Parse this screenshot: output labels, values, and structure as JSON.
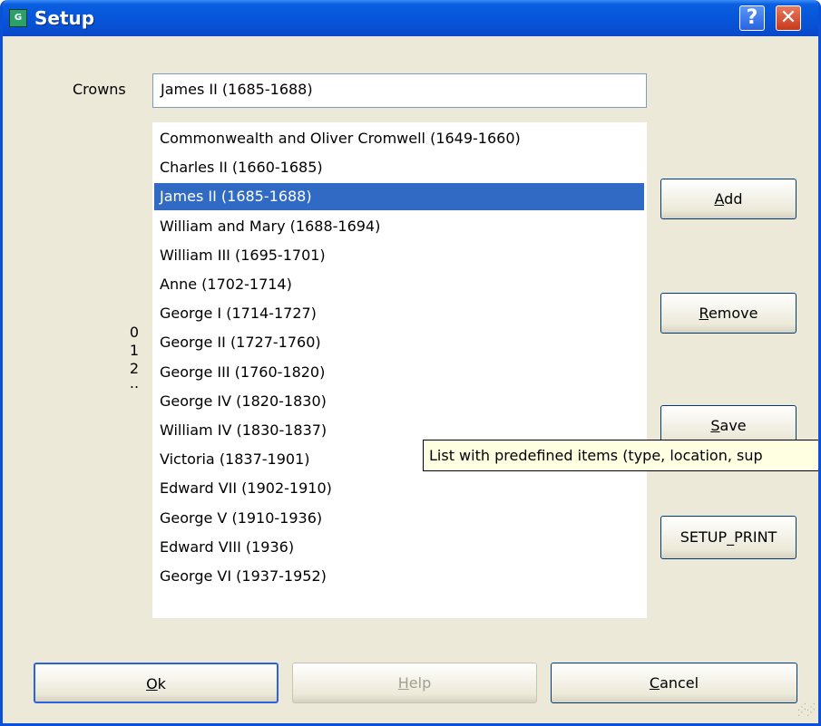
{
  "window": {
    "title": "Setup",
    "app_icon": "setup-app-icon",
    "help_glyph": "?",
    "close_glyph": "✕"
  },
  "crowns": {
    "label": "Crowns",
    "value": "James II (1685-1688)"
  },
  "list": {
    "items": [
      "Commonwealth and Oliver Cromwell (1649-1660)",
      "Charles II (1660-1685)",
      "James II (1685-1688)",
      "William and Mary (1688-1694)",
      "William III (1695-1701)",
      "Anne (1702-1714)",
      "George I (1714-1727)",
      "George II (1727-1760)",
      "George III (1760-1820)",
      "George IV (1820-1830)",
      "William IV (1830-1837)",
      "Victoria (1837-1901)",
      "Edward VII (1902-1910)",
      "George V (1910-1936)",
      "Edward VIII (1936)",
      "George VI (1937-1952)"
    ],
    "selected_index": 2
  },
  "side_digits": [
    "0",
    "1",
    "2",
    ".."
  ],
  "buttons": {
    "add": {
      "key": "A",
      "rest": "dd"
    },
    "remove": {
      "key": "R",
      "rest": "emove"
    },
    "save": {
      "key": "S",
      "rest": "ave"
    },
    "setup_print": "SETUP_PRINT",
    "ok": {
      "key": "O",
      "rest": "k"
    },
    "help": {
      "key": "H",
      "rest": "elp"
    },
    "cancel": {
      "key": "C",
      "rest": "ancel"
    }
  },
  "tooltip": "List with predefined items (type, location, sup",
  "colors": {
    "title_bar": "#0754d9",
    "selection": "#316ac5",
    "dialog_bg": "#ece9d8",
    "tooltip_bg": "#ffffe1"
  }
}
